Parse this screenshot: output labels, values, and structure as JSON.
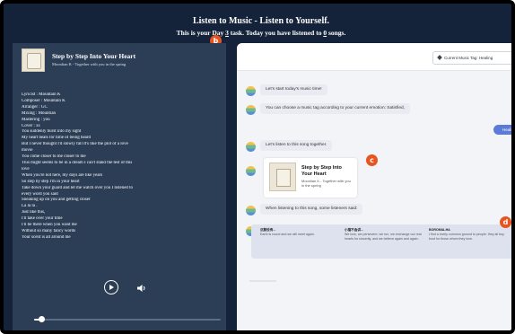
{
  "header": {
    "title": "Listen to Music - Listen to Yourself.",
    "sub_prefix": "This is your Day ",
    "day": "3",
    "sub_mid": " task. Today you have listened to ",
    "songs": "0",
    "sub_suffix": " songs."
  },
  "badges": {
    "b": "b",
    "c": "c",
    "d": "d"
  },
  "player": {
    "song_title": "Step by Step Into Your Heart",
    "song_artist": "Moonlian K - Together with you in the spring",
    "lyrics": [
      "Lyricist : Mountain K",
      "Composer : Mountain K",
      "Arranger : GC",
      "Mixing : Mountian",
      "Mastering : you",
      "Cover : xs",
      "You suddenly burst into my sight",
      "My heart beats for time of being heard",
      "But I never thought I'd slowly fall It's like the plot of a love",
      "movie",
      "You come closer to me closer to me",
      "This might seems to be in a dream I can't stand the test of this",
      "love",
      "When you're not here, my days are like years",
      "So step by step I'm in your heart",
      "Take down your guard and let me watch over you I listened to",
      "every word you said",
      "Sneaking up on you and getting closer",
      "La la la .",
      "Just like this,",
      "I'll take over your time",
      "I'll be there when you want me",
      "Without so many fancy words",
      "Your scent is all around me"
    ],
    "progress": 0.04,
    "play_icon": "play-circle-icon",
    "volume_icon": "volume-icon"
  },
  "chat": {
    "tag_button": "Current Music Tag: Healing",
    "tag_icon": "tag-icon",
    "messages": [
      "Let's start today's music time!",
      "You can choose a music tag according to your current emotion: Satisfied,",
      "Let's listen to this song together.",
      "When listening to this song, some listeners said:"
    ],
    "user_reply": "Healing",
    "card": {
      "title": "Step by Step Into Your Heart",
      "subtitle": "Moonlian K - Together with you in the spring"
    },
    "comments": [
      {
        "user": "沉默没有...",
        "text": "Earth is round and we will meet again."
      },
      {
        "user": "小猫不会讲...",
        "text": "We love, we persevere, we run, we exchange our real hearts for sincerity, and we believe again and again."
      },
      {
        "user": "BOROMIA-HA",
        "text": "I find a lovely common ground to people: they all buy food for those whom they love."
      }
    ]
  },
  "colors": {
    "accent": "#e8531f",
    "user_bubble": "#5b7bd6",
    "background": "#14233a"
  }
}
